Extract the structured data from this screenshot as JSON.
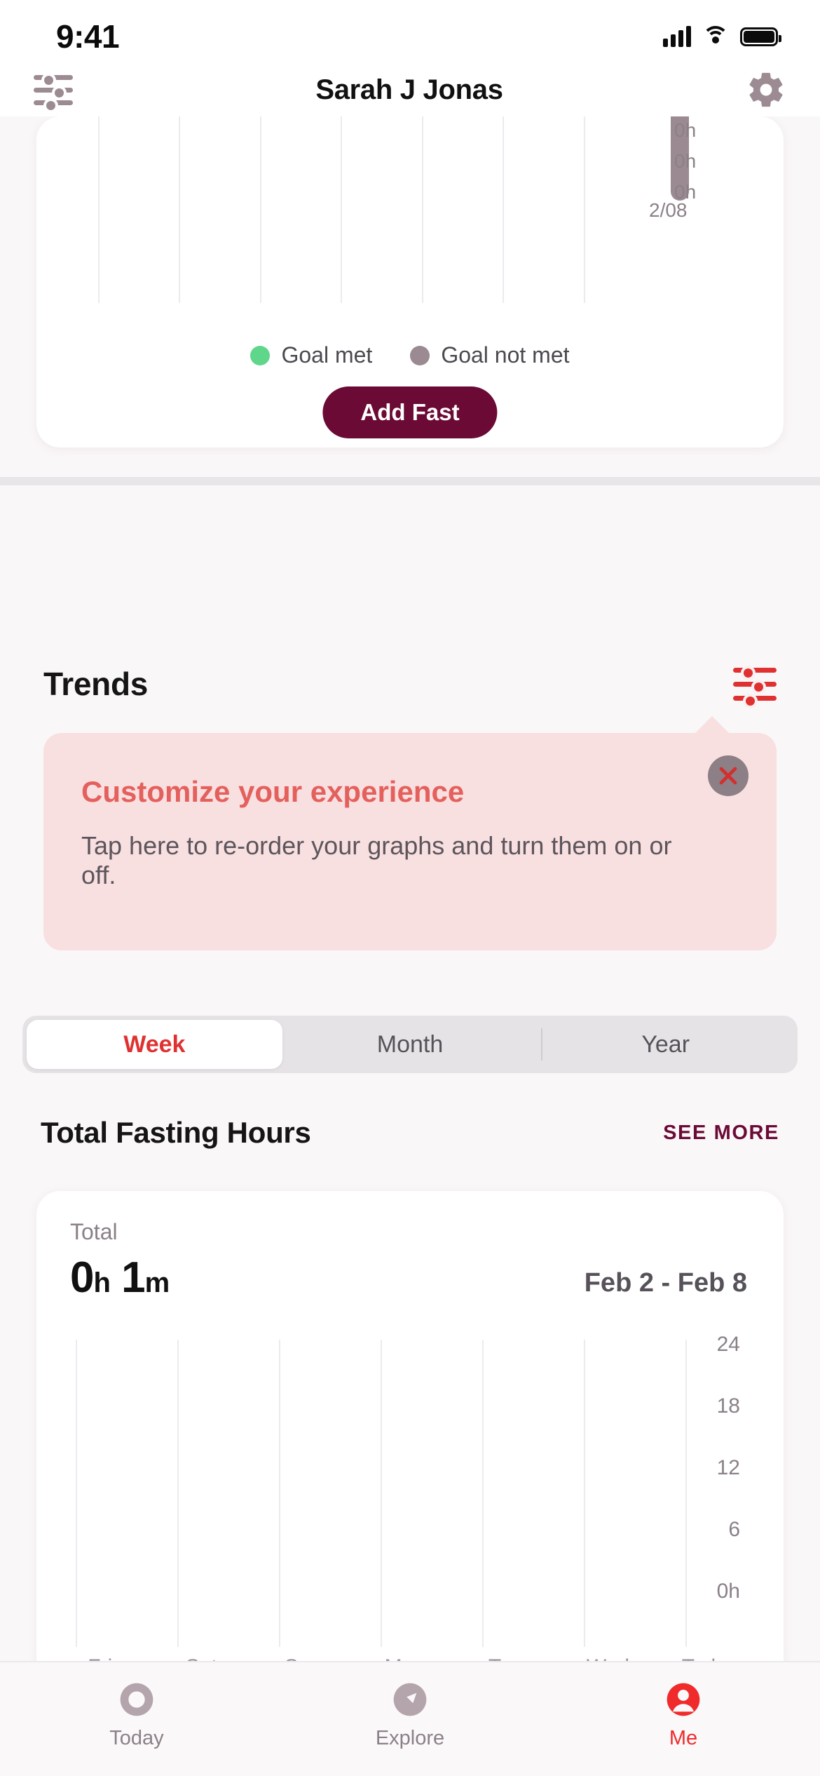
{
  "status_bar": {
    "time": "9:41",
    "cellular_icon": "signal-bars-icon",
    "wifi_icon": "wifi-icon",
    "battery_icon": "battery-icon"
  },
  "nav": {
    "title": "Sarah J Jonas",
    "left_icon": "sliders-filter-icon",
    "right_icon": "gear-settings-icon"
  },
  "fasting_card": {
    "legend": [
      {
        "label": "Goal met",
        "color": "#5fd68a"
      },
      {
        "label": "Goal not met",
        "color": "#9b8a91"
      }
    ],
    "add_fast_label": "Add Fast",
    "chart_data": {
      "type": "bar",
      "title": "",
      "categories": [
        "",
        "",
        "",
        "",
        "",
        "",
        "2/08"
      ],
      "values": [
        0,
        0,
        0,
        0,
        0,
        0,
        0
      ],
      "ytick_labels": [
        "0h",
        "0h",
        "0h"
      ],
      "xlabel": "",
      "ylabel": "",
      "grid": true,
      "legend_position": "below",
      "note": "chart is clipped at top of viewport; only last bar (2/08) visible, goal not met color"
    }
  },
  "trends": {
    "title": "Trends",
    "customize_icon": "sliders-filter-icon",
    "callout": {
      "title": "Customize your experience",
      "body": "Tap here to re-order your graphs and turn them on or off.",
      "close_icon": "close-x-icon",
      "background": "#f8dfe0",
      "title_color": "#e4605c"
    },
    "range_tabs": {
      "options": [
        "Week",
        "Month",
        "Year"
      ],
      "selected": "Week",
      "selected_color": "#e03131"
    }
  },
  "total_fasting_hours": {
    "title": "Total Fasting Hours",
    "see_more_label": "SEE MORE",
    "see_more_color": "#6b0a35",
    "total_label": "Total",
    "total_hours": "0",
    "total_hours_unit": "h",
    "total_minutes": "1",
    "total_minutes_unit": "m",
    "date_range": "Feb 2 - Feb 8",
    "chart_data": {
      "type": "bar",
      "title": "Total Fasting Hours",
      "subtitle": "Feb 2 - Feb 8",
      "categories": [
        "Fri",
        "Sat",
        "Sun",
        "Mon",
        "Tue",
        "Wed",
        "Today"
      ],
      "values": [
        0,
        0,
        0,
        0,
        0,
        0,
        0
      ],
      "ylabel": "",
      "xlabel": "",
      "ytick_labels": [
        "24",
        "18",
        "12",
        "6",
        "0h"
      ],
      "yticks": [
        24,
        18,
        12,
        6,
        0
      ],
      "ylim": [
        0,
        24
      ],
      "grid": true,
      "legend_position": "none",
      "note": "all bars zero for the week; total is 0h 1m"
    }
  },
  "tabbar": {
    "items": [
      {
        "label": "Today",
        "icon": "circle-today-icon",
        "active": false
      },
      {
        "label": "Explore",
        "icon": "compass-explore-icon",
        "active": false
      },
      {
        "label": "Me",
        "icon": "person-me-icon",
        "active": true
      }
    ],
    "active_color": "#ef2b2b",
    "inactive_color": "#a89ba2"
  }
}
